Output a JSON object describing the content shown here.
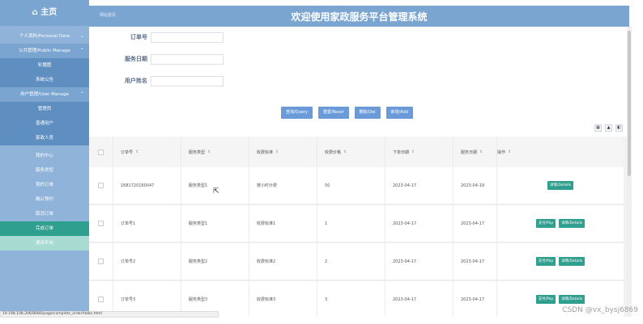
{
  "sidebar": {
    "home": "⌂ 主页",
    "items": [
      {
        "label": "个人资料/Personal Data",
        "chev": "⌄",
        "style": "light"
      },
      {
        "label": "公共管理/Public Manage",
        "chev": "⌃",
        "style": "header"
      },
      {
        "label": "轮播图",
        "style": "sub"
      },
      {
        "label": "系统公告",
        "style": "sub"
      },
      {
        "label": "用户管理/User Manage",
        "chev": "⌃",
        "style": "header"
      },
      {
        "label": "管理员",
        "style": "sub"
      },
      {
        "label": "普通用户",
        "style": "sub"
      },
      {
        "label": "家政人员",
        "style": "sub"
      },
      {
        "label": "我的中心",
        "style": "light"
      },
      {
        "label": "服务类型",
        "style": "light"
      },
      {
        "label": "我的订单",
        "style": "light"
      },
      {
        "label": "确认预约",
        "style": "light"
      },
      {
        "label": "取消订单",
        "style": "light"
      },
      {
        "label": "完成订单",
        "style": "active"
      },
      {
        "label": "退出平台",
        "style": "teal"
      }
    ]
  },
  "header": {
    "breadcrumb": "网站首页",
    "title": "欢迎使用家政服务平台管理系统"
  },
  "search": {
    "order_no_label": "订单号",
    "service_date_label": "服务日期",
    "user_name_label": "用户姓名",
    "order_no_value": "",
    "service_date_value": "",
    "user_name_value": ""
  },
  "buttons": {
    "query": "查询/Query",
    "reset": "重置/Reset",
    "delete": "删除/Del",
    "add": "新增/Add"
  },
  "toolbar_icons": [
    "grid-icon",
    "print-icon",
    "export-icon"
  ],
  "table": {
    "columns": [
      "订单号",
      "服务类型",
      "收费标准",
      "收费价格",
      "下单日期",
      "服务日期",
      "操作"
    ],
    "sort_glyph": "⇕",
    "rows": [
      {
        "order_no": "1681720160047",
        "service_type": "服务类型1",
        "fee_std": "按小时计费",
        "price": "50",
        "order_date": "2023-04-17",
        "service_date": "2023-04-19",
        "actions": [
          "详情/Details"
        ]
      },
      {
        "order_no": "订单号1",
        "service_type": "服务类型1",
        "fee_std": "收费标准1",
        "price": "1",
        "order_date": "2023-04-17",
        "service_date": "2023-04-17",
        "actions": [
          "支付/Pay",
          "详情/Details"
        ]
      },
      {
        "order_no": "订单号2",
        "service_type": "服务类型2",
        "fee_std": "收费标准2",
        "price": "2",
        "order_date": "2023-04-17",
        "service_date": "2023-04-17",
        "actions": [
          "支付/Pay",
          "详情/Details"
        ]
      },
      {
        "order_no": "订单号3",
        "service_type": "服务类型3",
        "fee_std": "收费标准3",
        "price": "3",
        "order_date": "2023-04-17",
        "service_date": "2023-04-17",
        "actions": [
          "支付/Pay",
          "详情/Details"
        ]
      }
    ]
  },
  "statusbar": "19.198.108.206/8080/page/complete_order/table.html",
  "watermark": "CSDN @vx_bysj6869",
  "colors": {
    "accent": "#7aa5d1",
    "action": "#2f9f8f",
    "button": "#6a9bd8"
  }
}
